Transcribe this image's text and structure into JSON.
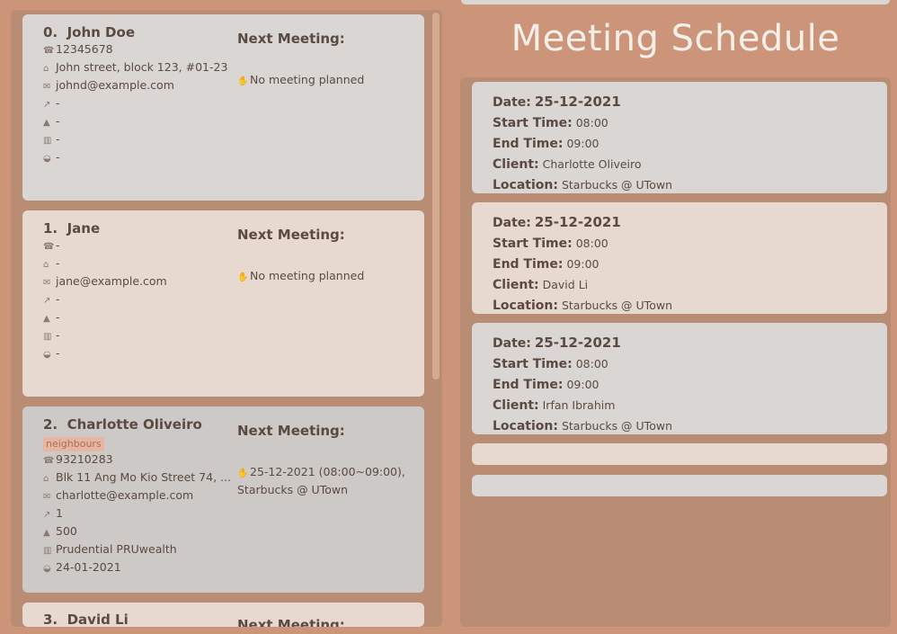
{
  "persons": [
    {
      "index": "0.",
      "name": "John Doe",
      "tag": "",
      "phone": "12345678",
      "address": "John street, block 123, #01-23",
      "email": "johnd@example.com",
      "field1": "-",
      "field2": "-",
      "field3": "-",
      "field4": "-",
      "next_meeting_label": "Next Meeting:",
      "next_meeting": "No meeting planned"
    },
    {
      "index": "1.",
      "name": "Jane",
      "tag": "",
      "phone": "-",
      "address": "-",
      "email": "jane@example.com",
      "field1": "-",
      "field2": "-",
      "field3": "-",
      "field4": "-",
      "next_meeting_label": "Next Meeting:",
      "next_meeting": "No meeting planned"
    },
    {
      "index": "2.",
      "name": "Charlotte Oliveiro",
      "tag": "neighbours",
      "phone": "93210283",
      "address": "Blk 11 Ang Mo Kio Street 74, ...",
      "email": "charlotte@example.com",
      "field1": "1",
      "field2": "500",
      "field3": "Prudential PRUwealth",
      "field4": "24-01-2021",
      "next_meeting_label": "Next Meeting:",
      "next_meeting": "25-12-2021 (08:00~09:00),",
      "next_meeting_location": "Starbucks @ UTown"
    },
    {
      "index": "3.",
      "name": "David Li",
      "next_meeting_label": "Next Meeting:"
    }
  ],
  "schedule": {
    "title": "Meeting Schedule",
    "labels": {
      "date": "Date:",
      "start": "Start Time:",
      "end": "End Time:",
      "client": "Client:",
      "location": "Location:"
    },
    "meetings": [
      {
        "date": "25-12-2021",
        "start": "08:00",
        "end": "09:00",
        "client": "Charlotte Oliveiro",
        "location": "Starbucks @ UTown"
      },
      {
        "date": "25-12-2021",
        "start": "08:00",
        "end": "09:00",
        "client": "David Li",
        "location": "Starbucks @ UTown"
      },
      {
        "date": "25-12-2021",
        "start": "08:00",
        "end": "09:00",
        "client": "Irfan Ibrahim",
        "location": "Starbucks @ UTown"
      }
    ]
  },
  "icons": {
    "phone": "phone-icon",
    "address": "house-icon",
    "email": "envelope-icon",
    "field1": "chart-icon",
    "field2": "money-bag-icon",
    "field3": "bank-icon",
    "field4": "handshake-icon",
    "meeting": "meeting-icon"
  },
  "colors": {
    "background": "#cc9478",
    "panel": "#b98d74",
    "card_light": "#d9d6d3",
    "card_pink": "#e8d9d0",
    "card_selected": "#ccc9c6",
    "title": "#f5efe9"
  }
}
